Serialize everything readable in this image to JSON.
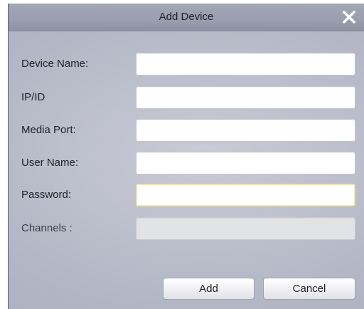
{
  "dialog": {
    "title": "Add Device",
    "close_icon": "close-icon"
  },
  "form": {
    "fields": [
      {
        "label": "Device Name:",
        "value": "",
        "placeholder": ""
      },
      {
        "label": "IP/ID",
        "value": "",
        "placeholder": ""
      },
      {
        "label": "Media Port:",
        "value": "",
        "placeholder": ""
      },
      {
        "label": "User Name:",
        "value": "",
        "placeholder": ""
      },
      {
        "label": "Password:",
        "value": "",
        "placeholder": ""
      },
      {
        "label": "Channels :",
        "value": "",
        "placeholder": ""
      }
    ]
  },
  "buttons": {
    "add": "Add",
    "cancel": "Cancel"
  }
}
